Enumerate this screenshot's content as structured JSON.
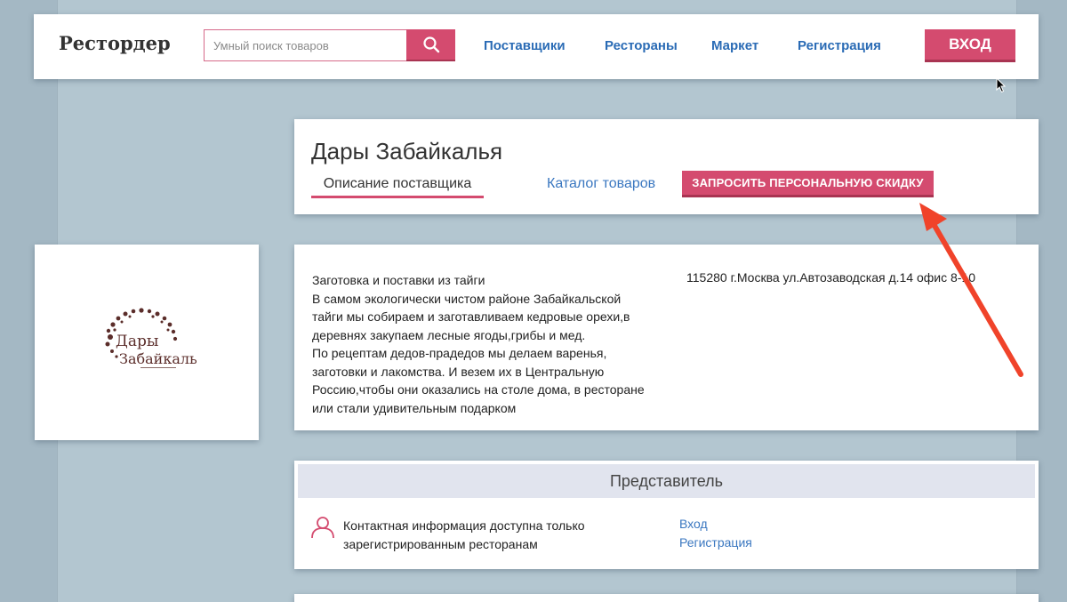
{
  "header": {
    "logo": "Рестордер",
    "search": {
      "placeholder": "Умный поиск товаров",
      "value": ""
    },
    "nav": [
      {
        "label": "Поставщики"
      },
      {
        "label": "Рестораны"
      },
      {
        "label": "Маркет"
      },
      {
        "label": "Регистрация"
      }
    ],
    "login_label": "ВХОД"
  },
  "supplier": {
    "name": "Дары Забайкалья",
    "tabs": {
      "description": "Описание поставщика",
      "catalog": "Каталог товаров"
    },
    "discount_button": "ЗАПРОСИТЬ ПЕРСОНАЛЬНУЮ СКИДКУ",
    "logo_text": {
      "line1": "Дары",
      "line2": "Забайкалья"
    },
    "description_lines": [
      "Заготовка и поставки из тайги",
      "В самом экологически чистом районе Забайкальской",
      "тайги мы собираем и заготавливаем кедровые орехи,в",
      "деревнях закупаем лесные ягоды,грибы и мед.",
      "По рецептам дедов-прадедов мы делаем варенья,",
      "заготовки и лакомства. И везем их в Центральную",
      "Россию,чтобы они оказались на столе дома, в ресторане",
      "или стали удивительным подарком"
    ],
    "address": "115280 г.Москва ул.Автозаводская д.14 офис 8-10"
  },
  "representative": {
    "title": "Представитель",
    "info_lines": [
      "Контактная информация доступна только",
      "зарегистрированным ресторанам"
    ],
    "login_link": "Вход",
    "register_link": "Регистрация"
  },
  "colors": {
    "accent": "#d44b6f",
    "link": "#2a6bb5",
    "background": "#a4b8c4",
    "annotation_arrow": "#f0432a"
  },
  "icons": [
    "search-icon",
    "user-icon",
    "cursor-icon",
    "annotation-arrow"
  ]
}
